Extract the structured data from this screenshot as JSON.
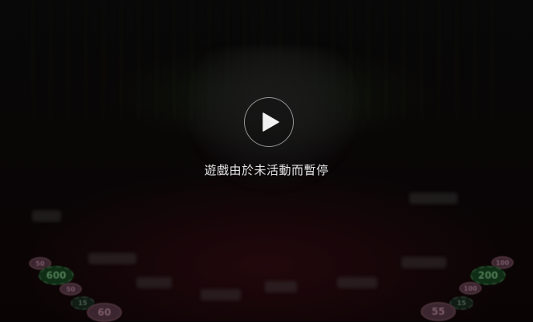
{
  "overlay": {
    "message": "遊戲由於未活動而暫停",
    "play_icon": "play-icon"
  },
  "table_chips": [
    {
      "label": "50"
    },
    {
      "label": "600"
    },
    {
      "label": "50"
    },
    {
      "label": "15"
    },
    {
      "label": "60"
    },
    {
      "label": "100"
    },
    {
      "label": "200"
    },
    {
      "label": "100"
    },
    {
      "label": "15"
    },
    {
      "label": "55"
    }
  ],
  "colors": {
    "overlay_text": "#e6e6e6",
    "play_border": "#ffffff",
    "felt": "#23080c"
  }
}
